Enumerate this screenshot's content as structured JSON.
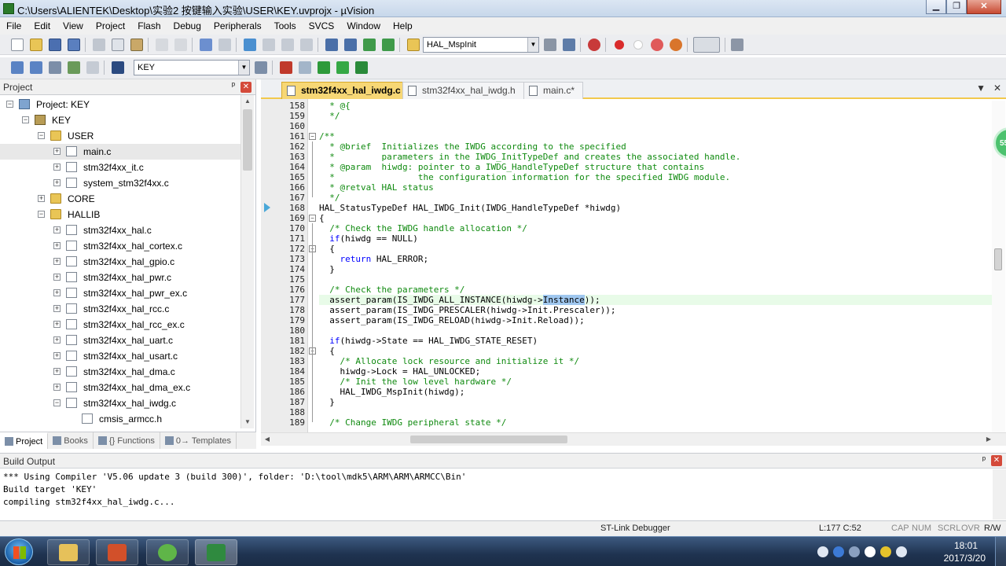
{
  "window": {
    "title": "C:\\Users\\ALIENTEK\\Desktop\\实验2 按键输入实验\\USER\\KEY.uvprojx - µVision",
    "min": "▁",
    "max": "❐",
    "close": "✕"
  },
  "menu": [
    "File",
    "Edit",
    "View",
    "Project",
    "Flash",
    "Debug",
    "Peripherals",
    "Tools",
    "SVCS",
    "Window",
    "Help"
  ],
  "toolbar": {
    "function_combo": "HAL_MspInit",
    "target_combo": "KEY"
  },
  "project_panel": {
    "title": "Project",
    "pin": "ᵖ",
    "close": "✕",
    "tree": [
      {
        "label": "Project: KEY",
        "exp": "−",
        "icon": "proj"
      },
      {
        "label": "KEY",
        "exp": "−",
        "icon": "target"
      },
      {
        "label": "USER",
        "exp": "−",
        "icon": "folder"
      },
      {
        "label": "main.c",
        "exp": "+",
        "icon": "file"
      },
      {
        "label": "stm32f4xx_it.c",
        "exp": "+",
        "icon": "file"
      },
      {
        "label": "system_stm32f4xx.c",
        "exp": "+",
        "icon": "file"
      },
      {
        "label": "CORE",
        "exp": "+",
        "icon": "folder"
      },
      {
        "label": "HALLIB",
        "exp": "−",
        "icon": "folder"
      },
      {
        "label": "stm32f4xx_hal.c",
        "exp": "+",
        "icon": "file"
      },
      {
        "label": "stm32f4xx_hal_cortex.c",
        "exp": "+",
        "icon": "file"
      },
      {
        "label": "stm32f4xx_hal_gpio.c",
        "exp": "+",
        "icon": "file"
      },
      {
        "label": "stm32f4xx_hal_pwr.c",
        "exp": "+",
        "icon": "file"
      },
      {
        "label": "stm32f4xx_hal_pwr_ex.c",
        "exp": "+",
        "icon": "file"
      },
      {
        "label": "stm32f4xx_hal_rcc.c",
        "exp": "+",
        "icon": "file"
      },
      {
        "label": "stm32f4xx_hal_rcc_ex.c",
        "exp": "+",
        "icon": "file"
      },
      {
        "label": "stm32f4xx_hal_uart.c",
        "exp": "+",
        "icon": "file"
      },
      {
        "label": "stm32f4xx_hal_usart.c",
        "exp": "+",
        "icon": "file"
      },
      {
        "label": "stm32f4xx_hal_dma.c",
        "exp": "+",
        "icon": "file"
      },
      {
        "label": "stm32f4xx_hal_dma_ex.c",
        "exp": "+",
        "icon": "file"
      },
      {
        "label": "stm32f4xx_hal_iwdg.c",
        "exp": "−",
        "icon": "file"
      },
      {
        "label": "cmsis_armcc.h",
        "exp": "",
        "icon": "file"
      }
    ],
    "tabs": [
      {
        "label": "Project",
        "active": true
      },
      {
        "label": "Books",
        "active": false
      },
      {
        "label": "{} Functions",
        "active": false
      },
      {
        "label": "0→ Templates",
        "active": false
      }
    ]
  },
  "editor": {
    "tabs": [
      {
        "label": "stm32f4xx_hal_iwdg.c",
        "active": true
      },
      {
        "label": "stm32f4xx_hal_iwdg.h",
        "active": false
      },
      {
        "label": "main.c*",
        "active": false
      }
    ],
    "tab_dropdown": "▼",
    "tab_close": "✕",
    "lines": [
      {
        "n": "158",
        "code": "  * @{"
      },
      {
        "n": "159",
        "code": "  */"
      },
      {
        "n": "160",
        "code": ""
      },
      {
        "n": "161",
        "code": "/**"
      },
      {
        "n": "162",
        "code": "  * @brief  Initializes the IWDG according to the specified"
      },
      {
        "n": "163",
        "code": "  *         parameters in the IWDG_InitTypeDef and creates the associated handle."
      },
      {
        "n": "164",
        "code": "  * @param  hiwdg: pointer to a IWDG_HandleTypeDef structure that contains"
      },
      {
        "n": "165",
        "code": "  *                the configuration information for the specified IWDG module."
      },
      {
        "n": "166",
        "code": "  * @retval HAL status"
      },
      {
        "n": "167",
        "code": "  */"
      },
      {
        "n": "168",
        "code": "HAL_StatusTypeDef HAL_IWDG_Init(IWDG_HandleTypeDef *hiwdg)"
      },
      {
        "n": "169",
        "code": "{"
      },
      {
        "n": "170",
        "code": "  /* Check the IWDG handle allocation */"
      },
      {
        "n": "171",
        "code": "  if(hiwdg == NULL)"
      },
      {
        "n": "172",
        "code": "  {"
      },
      {
        "n": "173",
        "code": "    return HAL_ERROR;"
      },
      {
        "n": "174",
        "code": "  }"
      },
      {
        "n": "175",
        "code": ""
      },
      {
        "n": "176",
        "code": "  /* Check the parameters */"
      },
      {
        "n": "177",
        "code": "  assert_param(IS_IWDG_ALL_INSTANCE(hiwdg->Instance));"
      },
      {
        "n": "178",
        "code": "  assert_param(IS_IWDG_PRESCALER(hiwdg->Init.Prescaler));"
      },
      {
        "n": "179",
        "code": "  assert_param(IS_IWDG_RELOAD(hiwdg->Init.Reload));"
      },
      {
        "n": "180",
        "code": ""
      },
      {
        "n": "181",
        "code": "  if(hiwdg->State == HAL_IWDG_STATE_RESET)"
      },
      {
        "n": "182",
        "code": "  {"
      },
      {
        "n": "183",
        "code": "    /* Allocate lock resource and initialize it */"
      },
      {
        "n": "184",
        "code": "    hiwdg->Lock = HAL_UNLOCKED;"
      },
      {
        "n": "185",
        "code": "    /* Init the low level hardware */"
      },
      {
        "n": "186",
        "code": "    HAL_IWDG_MspInit(hiwdg);"
      },
      {
        "n": "187",
        "code": "  }"
      },
      {
        "n": "188",
        "code": ""
      },
      {
        "n": "189",
        "code": "  /* Change IWDG peripheral state */"
      }
    ]
  },
  "build_output": {
    "title": "Build Output",
    "pin": "ᵖ",
    "close": "✕",
    "lines": [
      "*** Using Compiler 'V5.06 update 3 (build 300)', folder: 'D:\\tool\\mdk5\\ARM\\ARM\\ARMCC\\Bin'",
      "Build target 'KEY'",
      "compiling stm32f4xx_hal_iwdg.c..."
    ]
  },
  "statusbar": {
    "debugger": "ST-Link Debugger",
    "position": "L:177 C:52",
    "caps": "CAP",
    "num": "NUM",
    "scrl": "SCRL",
    "ovr": "OVR",
    "rw": "R/W"
  },
  "badge": "55",
  "taskbar": {
    "time": "18:01",
    "date": "2017/3/20"
  }
}
